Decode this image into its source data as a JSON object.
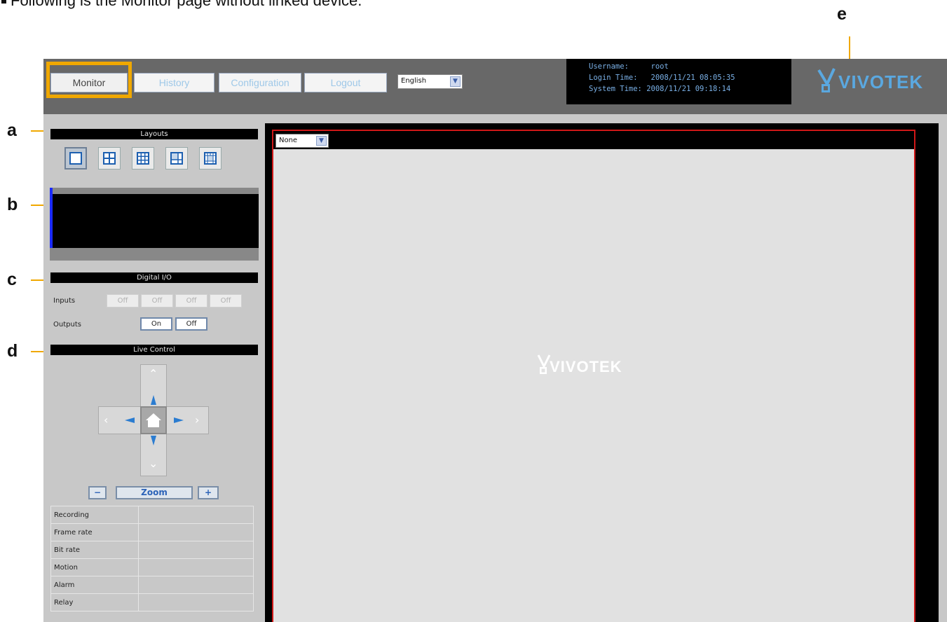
{
  "caption": "Following is the Monitor page without linked device.",
  "callouts": [
    "a",
    "b",
    "c",
    "d",
    "e"
  ],
  "nav": {
    "monitor": "Monitor",
    "history": "History",
    "configuration": "Configuration",
    "logout": "Logout",
    "language": "English"
  },
  "info": {
    "username_label": "Username:",
    "username": "root",
    "login_label": "Login Time:",
    "login_time": "2008/11/21 08:05:35",
    "system_label": "System Time:",
    "system_time": "2008/11/21 09:18:14"
  },
  "brand": "VIVOTEK",
  "layouts": {
    "title": "Layouts",
    "options": [
      "single-view-icon",
      "quad-view-icon",
      "nine-view-icon",
      "six-view-icon",
      "thirteen-view-icon"
    ],
    "selected": 0
  },
  "digital_io": {
    "title": "Digital I/O",
    "inputs_label": "Inputs",
    "inputs": [
      "Off",
      "Off",
      "Off",
      "Off"
    ],
    "outputs_label": "Outputs",
    "outputs": [
      "On",
      "Off"
    ]
  },
  "live_control": {
    "title": "Live Control",
    "zoom_label": "Zoom",
    "zoom_out": "−",
    "zoom_in": "+"
  },
  "status": [
    {
      "label": "Recording",
      "value": ""
    },
    {
      "label": "Frame rate",
      "value": ""
    },
    {
      "label": "Bit rate",
      "value": ""
    },
    {
      "label": "Motion",
      "value": ""
    },
    {
      "label": "Alarm",
      "value": ""
    },
    {
      "label": "Relay",
      "value": ""
    }
  ],
  "viewer": {
    "device_select": "None"
  },
  "colors": {
    "accent": "#f0a800",
    "topbar": "#686868",
    "selected_frame": "#d01818",
    "brand_blue": "#5aa8e0"
  }
}
